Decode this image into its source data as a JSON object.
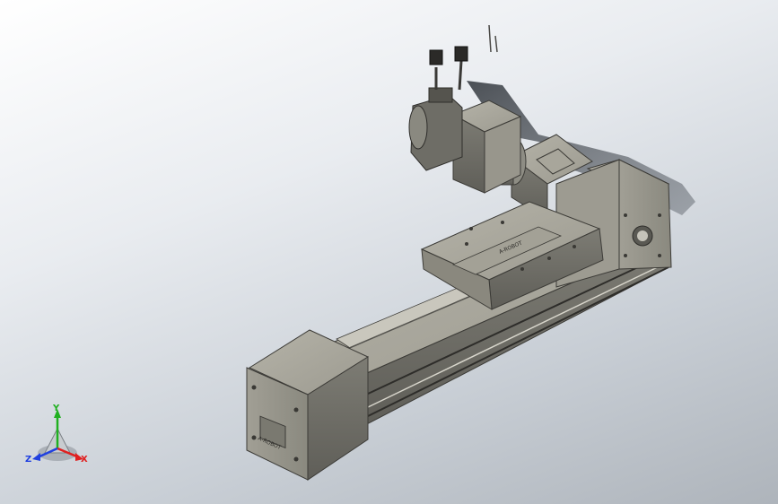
{
  "viewport": {
    "background_top": "#ffffff",
    "background_bottom": "#aeb4bb",
    "model_body_color": "#8c8b82",
    "model_shadow_color": "#3a3f45"
  },
  "model": {
    "front_plate_logo": "A-ROBOT",
    "carriage_logo": "A-ROBOT"
  },
  "triad": {
    "x_label": "X",
    "y_label": "Y",
    "z_label": "Z",
    "x_color": "#e02020",
    "y_color": "#20b020",
    "z_color": "#2040e0"
  }
}
